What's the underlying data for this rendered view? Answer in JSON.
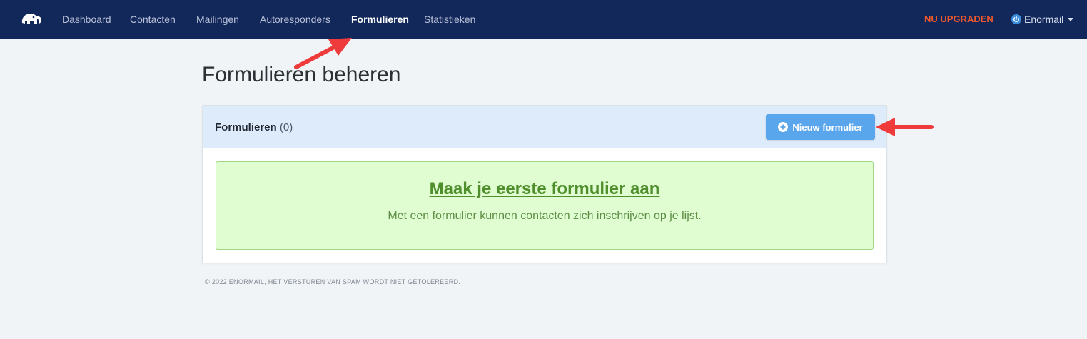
{
  "nav": {
    "items": [
      {
        "label": "Dashboard",
        "active": false
      },
      {
        "label": "Contacten",
        "active": false
      },
      {
        "label": "Mailingen",
        "active": false
      },
      {
        "label": "Autoresponders",
        "active": false
      },
      {
        "label": "Formulieren",
        "active": true
      },
      {
        "label": "Statistieken",
        "active": false
      }
    ],
    "upgrade_label": "NU UPGRADEN",
    "account_label": "Enormail",
    "logo_icon": "elephant-logo-icon",
    "account_icon": "power-icon"
  },
  "page": {
    "title": "Formulieren beheren"
  },
  "panel": {
    "title": "Formulieren",
    "count": "(0)",
    "new_button_label": "Nieuw formulier",
    "new_button_icon": "plus-circle-icon"
  },
  "empty_state": {
    "title": "Maak je eerste formulier aan",
    "subtitle": "Met een formulier kunnen contacten zich inschrijven op je lijst."
  },
  "footer": {
    "text": "© 2022 ENORMAIL, HET VERSTUREN VAN SPAM WORDT NIET GETOLEREERD."
  },
  "colors": {
    "navbar": "#13285a",
    "upgrade": "#f0582a",
    "button": "#5aa6ec",
    "empty_bg": "#e0fdd2",
    "empty_text": "#4e8e2b",
    "annotation_arrow": "#ef3b3b"
  }
}
